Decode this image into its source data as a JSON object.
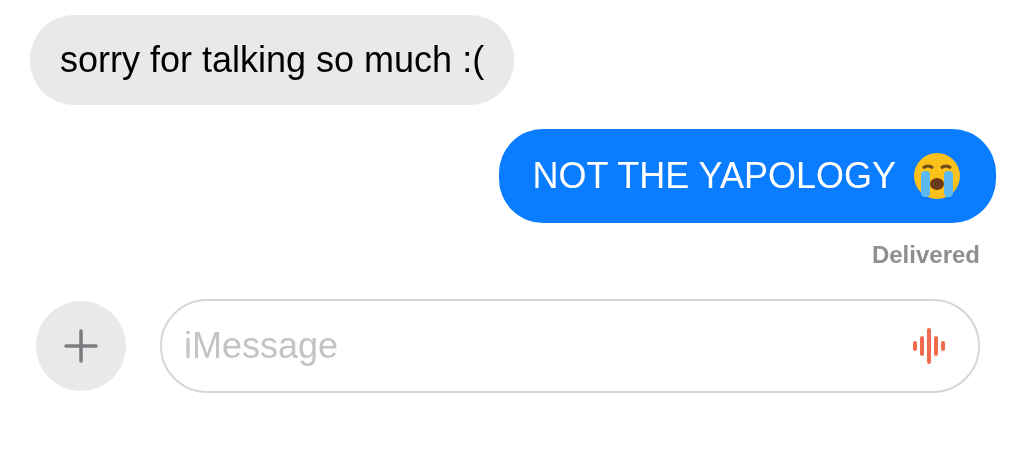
{
  "messages": [
    {
      "kind": "incoming",
      "text": "sorry for talking so much :("
    },
    {
      "kind": "outgoing",
      "text": "NOT THE YAPOLOGY",
      "crying_emoji": true
    }
  ],
  "status": "Delivered",
  "composer": {
    "placeholder": "iMessage"
  }
}
